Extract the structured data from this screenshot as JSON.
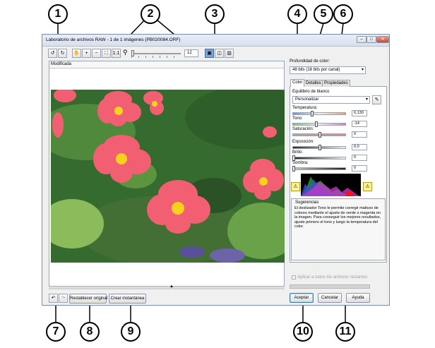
{
  "window": {
    "title": "Laboratorio de archivos RAW - 1 de 1 imágenes (PB020084.ORF)",
    "controls": {
      "minimize": "–",
      "maximize": "□",
      "close": "✕"
    }
  },
  "toolbar": {
    "zoom_value": "12"
  },
  "preview": {
    "view_label": "Modificada"
  },
  "bottom_left": {
    "undo": "↶",
    "redo": "↷",
    "reset_label": "Restablecer original",
    "snapshot_label": "Crear instantánea"
  },
  "panel": {
    "color_depth_label": "Profundidad de color:",
    "color_depth_value": "48 bits (16 bits por canal)",
    "tabs": [
      "Color",
      "Detalles",
      "Propiedades"
    ],
    "white_balance_label": "Equilibrio de blanco",
    "white_balance_value": "Personalizar",
    "temperature_label": "Temperatura:",
    "temperature_value": "6,130",
    "tint_label": "Tono:",
    "tint_value": "-14",
    "saturation_label": "Saturación:",
    "saturation_value": "0",
    "exposure_label": "Exposición:",
    "exposure_value": "0.0",
    "brightness_label": "Brillo:",
    "brightness_value": "0",
    "shadow_label": "Sombra:",
    "shadow_value": "0",
    "hints_title": "Sugerencias",
    "hints_text": "El deslizador Tono le permite corregir matices de colores mediante el ajuste de verde o magenta en la imagen. Para conseguir los mejores resultados, ajuste primero el tono y luego la temperatura del color.",
    "apply_all_label": "Aplicar a todos los archivos restantes"
  },
  "dialog_buttons": {
    "accept": "Aceptar",
    "cancel": "Cancelar",
    "help": "Ayuda"
  },
  "callouts": [
    "1",
    "2",
    "3",
    "4",
    "5",
    "6",
    "7",
    "8",
    "9",
    "10",
    "11"
  ]
}
